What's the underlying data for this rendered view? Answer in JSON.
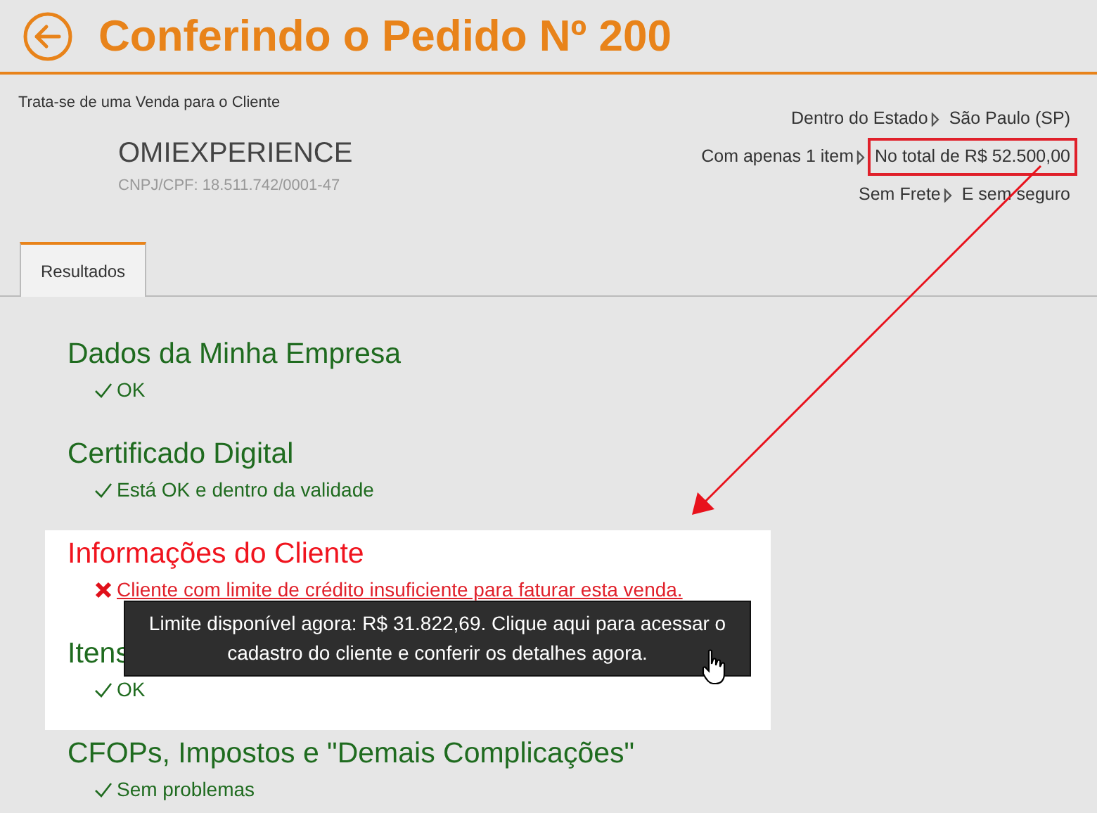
{
  "header": {
    "title": "Conferindo o Pedido Nº 200"
  },
  "client": {
    "intro": "Trata-se de uma Venda para o Cliente",
    "name": "OMIEXPERIENCE",
    "document": "CNPJ/CPF: 18.511.742/0001-47"
  },
  "summary": [
    {
      "label": "Dentro do Estado",
      "value": "São Paulo (SP)",
      "highlighted": false
    },
    {
      "label": "Com apenas 1 item",
      "value": "No total de R$ 52.500,00",
      "highlighted": true
    },
    {
      "label": "Sem Frete",
      "value": "E sem seguro",
      "highlighted": false
    }
  ],
  "tabs": [
    {
      "label": "Resultados",
      "selected": true
    }
  ],
  "sections": [
    {
      "title": "Dados da Minha Empresa",
      "kind": "ok",
      "message": "OK",
      "highlighted": false
    },
    {
      "title": "Certificado Digital",
      "kind": "ok",
      "message": "Está OK e dentro da validade",
      "highlighted": false
    },
    {
      "title": "Informações do Cliente",
      "kind": "error",
      "message": "Cliente com limite de crédito insuficiente para faturar esta venda.",
      "highlighted": true
    },
    {
      "title": "Itens",
      "kind": "ok",
      "message": "OK",
      "highlighted": true
    },
    {
      "title": "CFOPs, Impostos e \"Demais Complicações\"",
      "kind": "ok",
      "message": "Sem problemas",
      "highlighted": false
    }
  ],
  "tooltip": {
    "text": "Limite disponível agora: R$ 31.822,69. Clique aqui para acessar o cadastro do cliente e conferir os detalhes agora."
  }
}
